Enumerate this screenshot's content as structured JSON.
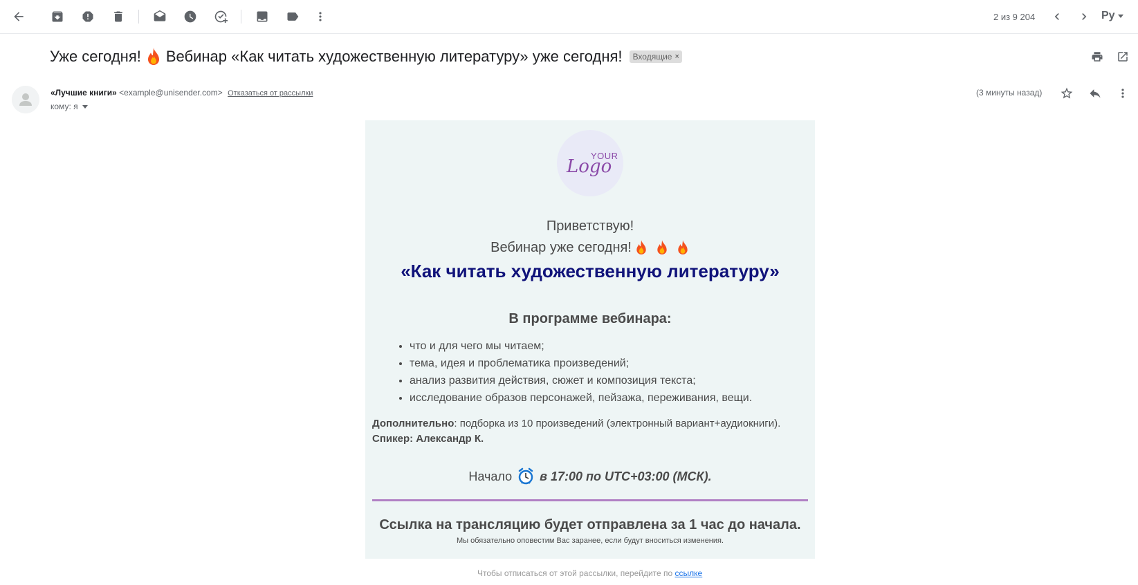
{
  "toolbar": {
    "icons": [
      "back-arrow-icon",
      "archive-icon",
      "report-spam-icon",
      "delete-icon",
      "mark-unread-icon",
      "snooze-icon",
      "add-task-icon",
      "move-to-icon",
      "label-icon",
      "more-vert-icon"
    ],
    "counter": "2 из 9 204",
    "language": "Ру"
  },
  "email": {
    "subject_before": "Уже сегодня!",
    "subject_after": "Вебинар «Как читать художественную литературу» уже сегодня!",
    "label": "Входящие",
    "label_close": "×",
    "sender_name": "«Лучшие книги»",
    "sender_email": "<example@unisender.com>",
    "unsubscribe": "Отказаться от рассылки",
    "to": "кому: я",
    "time": "(3 минуты назад)"
  },
  "body": {
    "logo_your": "YOUR",
    "logo_text": "Logo",
    "greeting": "Приветствую!",
    "webinar_today": "Вебинар уже сегодня!",
    "title": "«Как читать художественную литературу»",
    "program_heading": "В программе вебинара:",
    "program_items": [
      "что и для чего мы читаем;",
      "тема, идея и проблематика произведений;",
      "анализ развития действия, сюжет и композиция текста;",
      "исследование образов персонажей, пейзажа, переживания, вещи."
    ],
    "extra_label": "Дополнительно",
    "extra_text": ": подборка из 10 произведений (электронный вариант+аудиокниги).",
    "speaker": "Спикер: Александр К.",
    "start_label": "Начало",
    "start_time": "в 17:00 по UTC+03:00 (МСК).",
    "link_note": "Ссылка на трансляцию будет отправлена за 1 час до начала.",
    "notify": "Мы обязательно оповестим Вас заранее, если будут вноситься изменения."
  },
  "footer": {
    "text": "Чтобы отписаться от этой рассылки, перейдите по",
    "link": "ссылке"
  },
  "colors": {
    "title": "#10137a",
    "mail_bg": "#eef5f5",
    "divider": "#b180c4",
    "logo": "#8b4aa8"
  }
}
